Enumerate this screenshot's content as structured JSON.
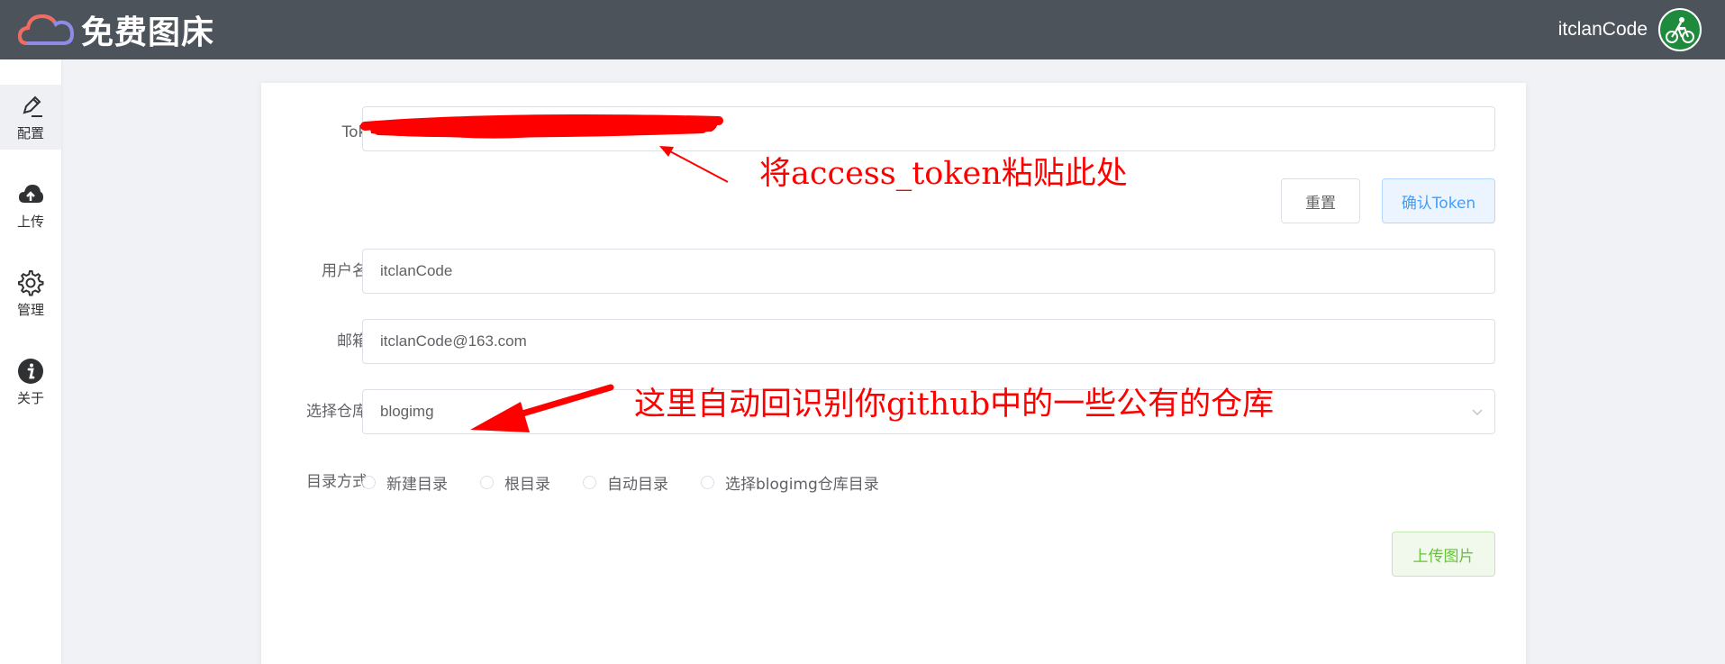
{
  "header": {
    "logo_text": "免费图床",
    "user_name": "itclanCode"
  },
  "sidebar": {
    "items": [
      {
        "label": "配置",
        "icon": "pen-icon",
        "active": true
      },
      {
        "label": "上传",
        "icon": "cloud-upload-icon",
        "active": false
      },
      {
        "label": "管理",
        "icon": "gear-icon",
        "active": false
      },
      {
        "label": "关于",
        "icon": "info-icon",
        "active": false
      }
    ]
  },
  "form": {
    "token": {
      "label": "Token",
      "value": ""
    },
    "reset_button": "重置",
    "confirm_button": "确认Token",
    "username": {
      "label": "用户名",
      "value": "itclanCode"
    },
    "email": {
      "label": "邮箱",
      "value": "itclanCode@163.com"
    },
    "repo": {
      "label": "选择仓库",
      "value": "blogimg"
    },
    "directory": {
      "label": "目录方式",
      "options": [
        "新建目录",
        "根目录",
        "自动目录",
        "选择blogimg仓库目录"
      ]
    },
    "upload_button": "上传图片"
  },
  "annotations": {
    "token_hint": "将access_token粘贴此处",
    "repo_hint": "这里自动回识别你github中的一些公有的仓库"
  },
  "colors": {
    "header_bg": "#4c535b",
    "annotation": "#ff0000",
    "primary": "#409eff",
    "success": "#67c23a"
  }
}
